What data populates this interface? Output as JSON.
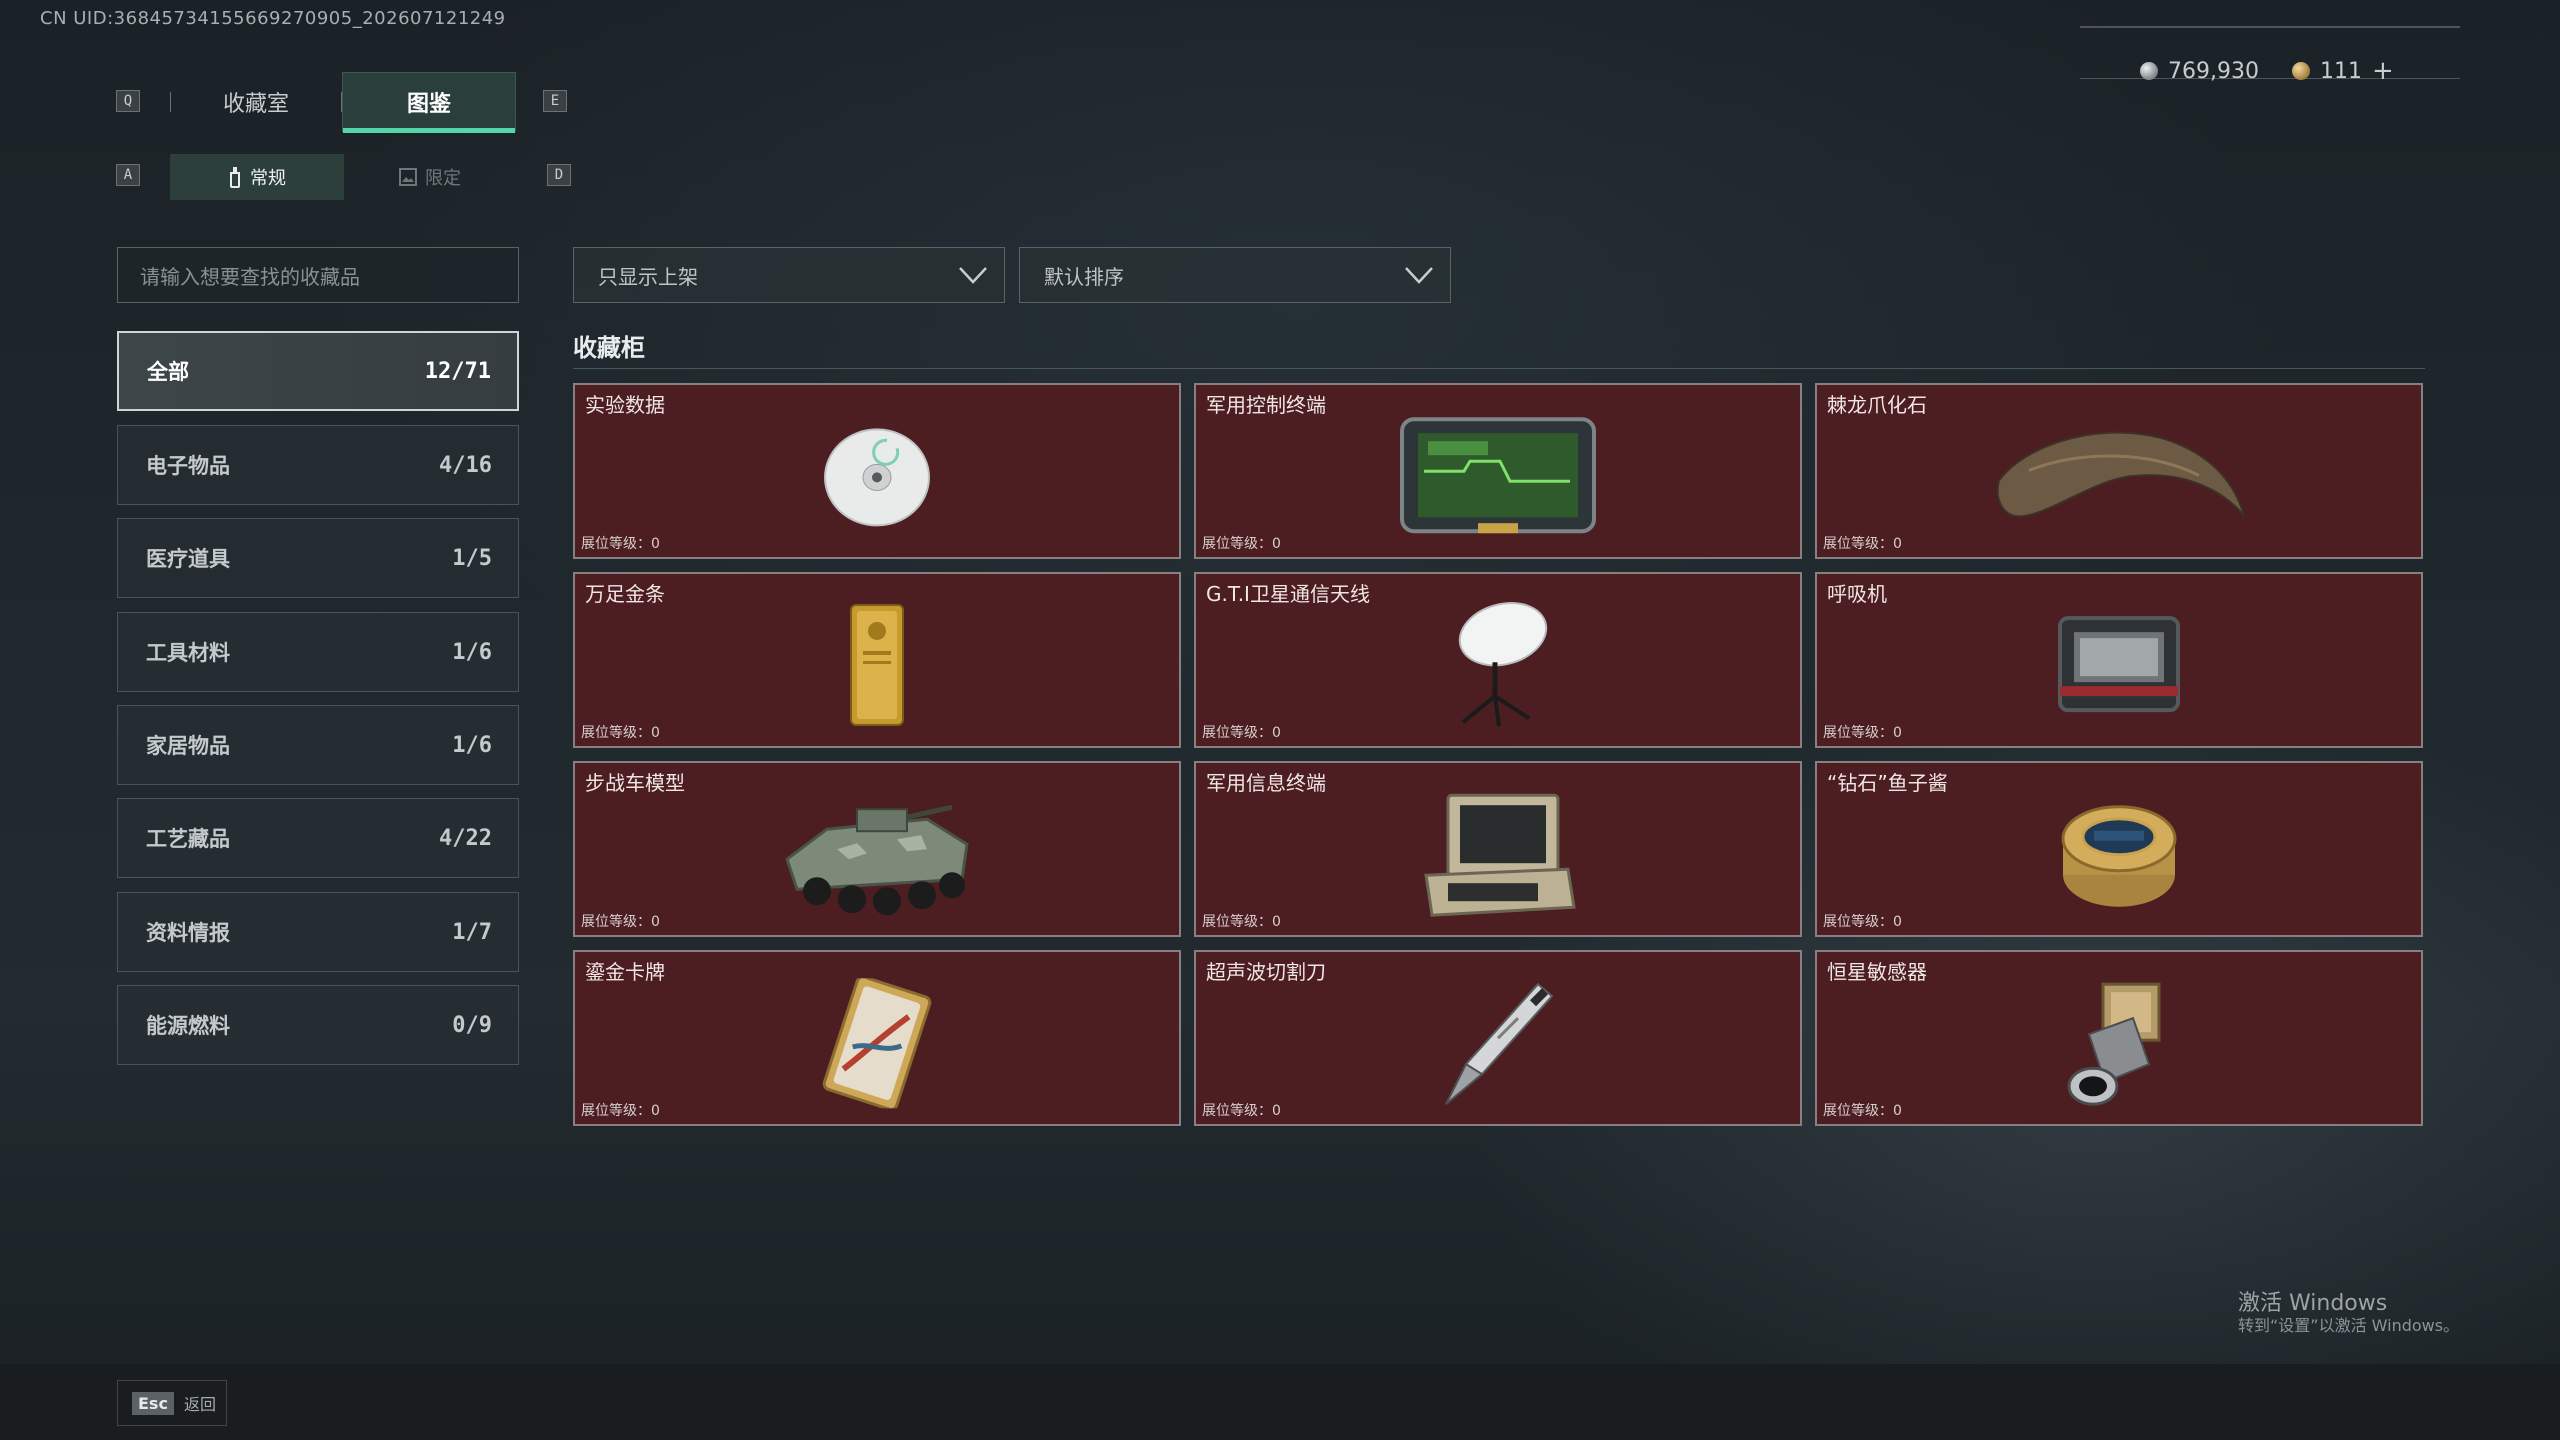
{
  "uid_text": "CN UID:36845734155669270905_202607121249",
  "keys": {
    "q": "Q",
    "e": "E",
    "a": "A",
    "d": "D"
  },
  "tabs": {
    "collection": "收藏室",
    "codex": "图鉴"
  },
  "subtabs": {
    "regular": "常规",
    "limited": "限定"
  },
  "currency": {
    "silver": "769,930",
    "gold": "111",
    "add": "+"
  },
  "search": {
    "placeholder": "请输入想要查找的收藏品"
  },
  "filters": {
    "shelf": "只显示上架",
    "sort": "默认排序"
  },
  "categories": [
    {
      "label": "全部",
      "count": "12/71",
      "active": true
    },
    {
      "label": "电子物品",
      "count": "4/16"
    },
    {
      "label": "医疗道具",
      "count": "1/5"
    },
    {
      "label": "工具材料",
      "count": "1/6"
    },
    {
      "label": "家居物品",
      "count": "1/6"
    },
    {
      "label": "工艺藏品",
      "count": "4/22"
    },
    {
      "label": "资料情报",
      "count": "1/7"
    },
    {
      "label": "能源燃料",
      "count": "0/9"
    }
  ],
  "section_title": "收藏柜",
  "items": [
    {
      "name": "实验数据",
      "level": "展位等级：0",
      "icon": "disc-icon"
    },
    {
      "name": "军用控制终端",
      "level": "展位等级：0",
      "icon": "terminal-icon"
    },
    {
      "name": "棘龙爪化石",
      "level": "展位等级：0",
      "icon": "claw-fossil-icon"
    },
    {
      "name": "万足金条",
      "level": "展位等级：0",
      "icon": "gold-bar-icon"
    },
    {
      "name": "G.T.I卫星通信天线",
      "level": "展位等级：0",
      "icon": "satellite-dish-icon"
    },
    {
      "name": "呼吸机",
      "level": "展位等级：0",
      "icon": "ventilator-icon"
    },
    {
      "name": "步战车模型",
      "level": "展位等级：0",
      "icon": "ifv-model-icon"
    },
    {
      "name": "军用信息终端",
      "level": "展位等级：0",
      "icon": "info-terminal-icon"
    },
    {
      "name": "“钻石”鱼子酱",
      "level": "展位等级：0",
      "icon": "caviar-tin-icon"
    },
    {
      "name": "鎏金卡牌",
      "level": "展位等级：0",
      "icon": "gilded-card-icon"
    },
    {
      "name": "超声波切割刀",
      "level": "展位等级：0",
      "icon": "ultrasonic-knife-icon"
    },
    {
      "name": "恒星敏感器",
      "level": "展位等级：0",
      "icon": "star-sensor-icon"
    }
  ],
  "footer": {
    "esc_key": "Esc",
    "back_label": "返回"
  },
  "watermark": {
    "line1": "激活 Windows",
    "line2": "转到“设置”以激活 Windows。"
  },
  "colors": {
    "card_bg": "#4c1d21",
    "accent": "#55d6a9",
    "active_tab": "#2a3f3b"
  }
}
